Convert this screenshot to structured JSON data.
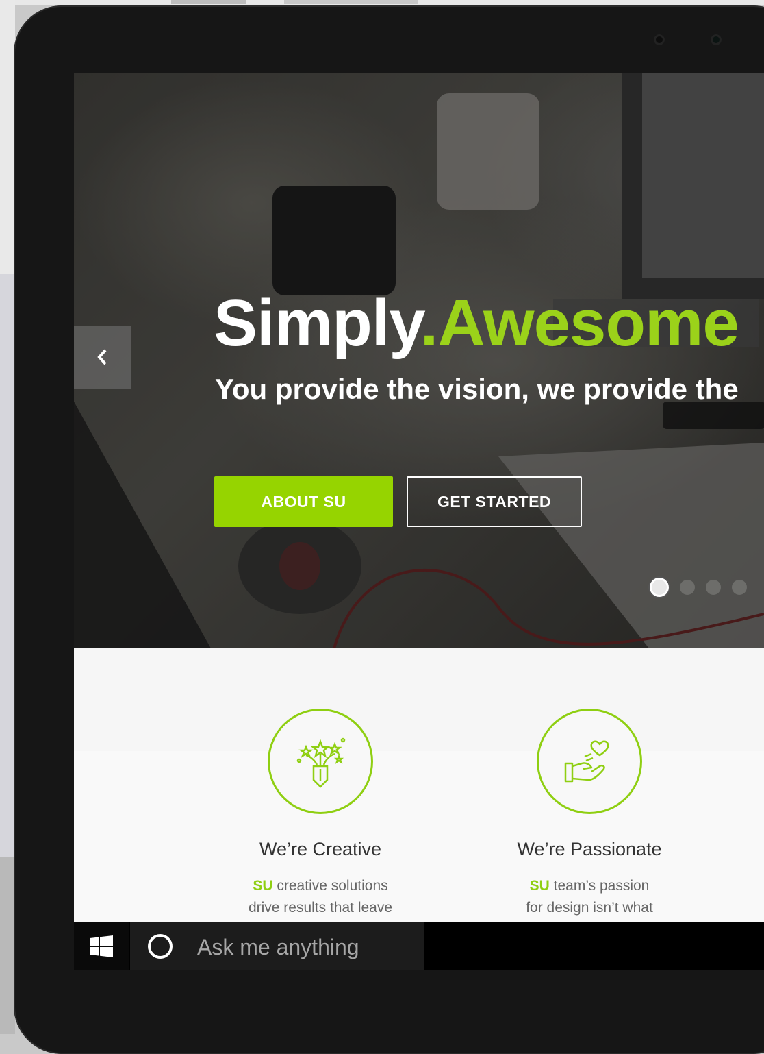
{
  "hero": {
    "headline_main": "Simply",
    "headline_accent": ".Awesome",
    "subline": "You provide the vision, we provide the",
    "about_button": "ABOUT SU",
    "start_button": "GET STARTED",
    "slide_count": 4,
    "active_slide": 1
  },
  "features": [
    {
      "icon": "pencil-stars-icon",
      "title": "We’re Creative",
      "brand": "SU",
      "line1": " creative solutions",
      "line2": "drive results that leave"
    },
    {
      "icon": "hand-heart-icon",
      "title": "We’re Passionate",
      "brand": "SU",
      "line1": " team’s passion",
      "line2": "for design isn’t what"
    }
  ],
  "taskbar": {
    "search_placeholder": "Ask me anything"
  },
  "colors": {
    "accent": "#96d400",
    "device": "#161616",
    "taskbar": "#000000"
  }
}
